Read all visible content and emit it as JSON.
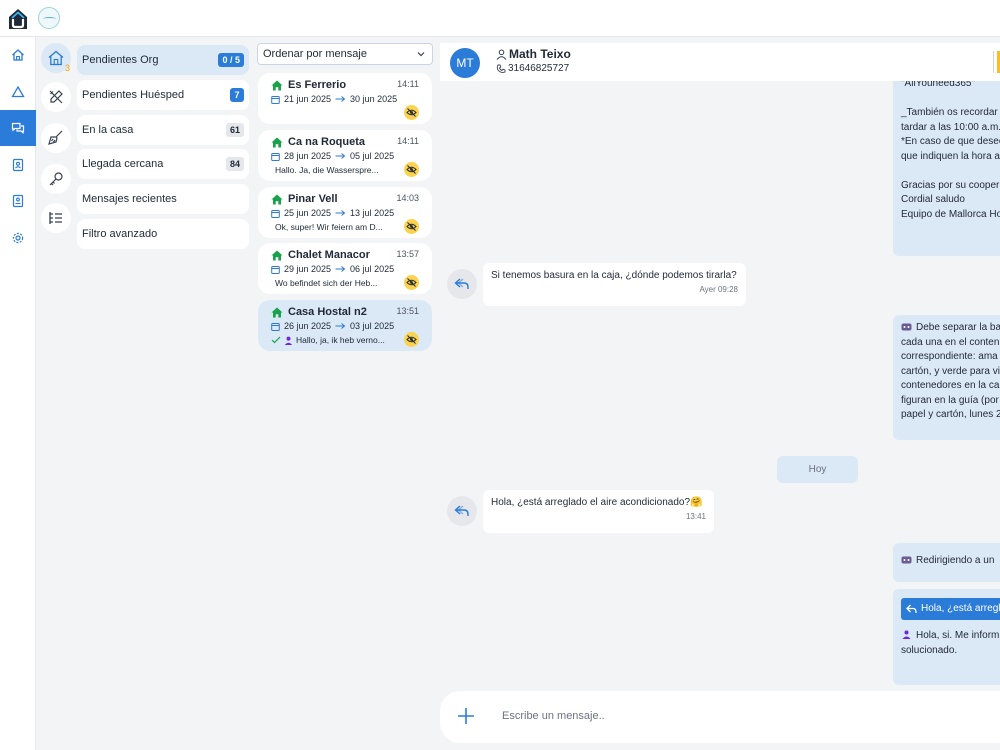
{
  "sidebar_nav": {
    "items": [
      {
        "name": "home-icon"
      },
      {
        "name": "alert-icon"
      },
      {
        "name": "chat-icon",
        "active": true
      },
      {
        "name": "contact-card-icon"
      },
      {
        "name": "address-book-icon"
      },
      {
        "name": "settings-icon"
      }
    ]
  },
  "categories": {
    "icons": [
      {
        "name": "house-icon",
        "count": "3"
      },
      {
        "name": "tools-icon"
      },
      {
        "name": "broom-icon"
      },
      {
        "name": "key-icon"
      },
      {
        "name": "list-icon"
      }
    ],
    "items": [
      {
        "label": "Pendientes Org",
        "badge": "0 / 5",
        "badge_style": "blue"
      },
      {
        "label": "Pendientes Huésped",
        "badge": "7",
        "badge_style": "blue"
      },
      {
        "label": "En la casa",
        "badge": "61",
        "badge_style": "grey"
      },
      {
        "label": "Llegada cercana",
        "badge": "84",
        "badge_style": "grey"
      },
      {
        "label": "Mensajes recientes"
      },
      {
        "label": "Filtro avanzado"
      }
    ]
  },
  "conversations": {
    "sort_label": "Ordenar por mensaje",
    "items": [
      {
        "name": "Es Ferrerio",
        "time": "14:11",
        "checkin": "21 jun 2025",
        "checkout": "30 jun 2025",
        "preview": ""
      },
      {
        "name": "Ca na Roqueta",
        "time": "14:11",
        "checkin": "28 jun 2025",
        "checkout": "05 jul 2025",
        "preview": "Hallo. Ja, die Wasserspre..."
      },
      {
        "name": "Pinar Vell",
        "time": "14:03",
        "checkin": "25 jun 2025",
        "checkout": "13 jul 2025",
        "preview": "Ok, super! Wir feiern am D..."
      },
      {
        "name": "Chalet Manacor",
        "time": "13:57",
        "checkin": "29 jun 2025",
        "checkout": "06 jul 2025",
        "preview": "Wo befindet sich der Heb..."
      },
      {
        "name": "Casa Hostal n2",
        "time": "13:51",
        "checkin": "26 jun 2025",
        "checkout": "03 jul 2025",
        "preview": "Hallo, ja, ik heb verno..."
      }
    ]
  },
  "chat": {
    "contact_initials": "MT",
    "contact_name": "Math Teixo",
    "contact_phone": "31646825727",
    "outgoing_1_lines": [
      "\"AllYouneed365\"",
      "",
      "_También os recordar",
      "tardar a las 10:00 a.m.",
      "*En caso de que desec",
      "que indiquen la hora a",
      "",
      "Gracias por su cooper",
      "Cordial saludo",
      "Equipo de Mallorca Ho"
    ],
    "incoming_1": {
      "text": "Si tenemos basura en la caja, ¿dónde podemos tirarla?",
      "time": "Ayer 09:28"
    },
    "outgoing_2_lines": [
      "Debe separar la ba",
      "cada una en el conten",
      "correspondiente: ama",
      "cartón, y verde para vi",
      "contenedores en la ca",
      "figuran en la guía (por",
      "papel y cartón, lunes 2"
    ],
    "day_separator": "Hoy",
    "incoming_2": {
      "text": "Hola, ¿está arreglado el aire acondicionado?🤗",
      "time": "13:41"
    },
    "outgoing_3": "Redirigiendo a un",
    "outgoing_4_quote": "Hola, ¿está arregla",
    "outgoing_4_lines": [
      "Hola, si. Me inform",
      "solucionado."
    ],
    "composer_placeholder": "Escribe un mensaje.."
  },
  "colors": {
    "accent": "#2b7bd8",
    "active_bg": "#dbe8f6",
    "house_green": "#16a34a",
    "hide_badge": "#fcd34d"
  }
}
